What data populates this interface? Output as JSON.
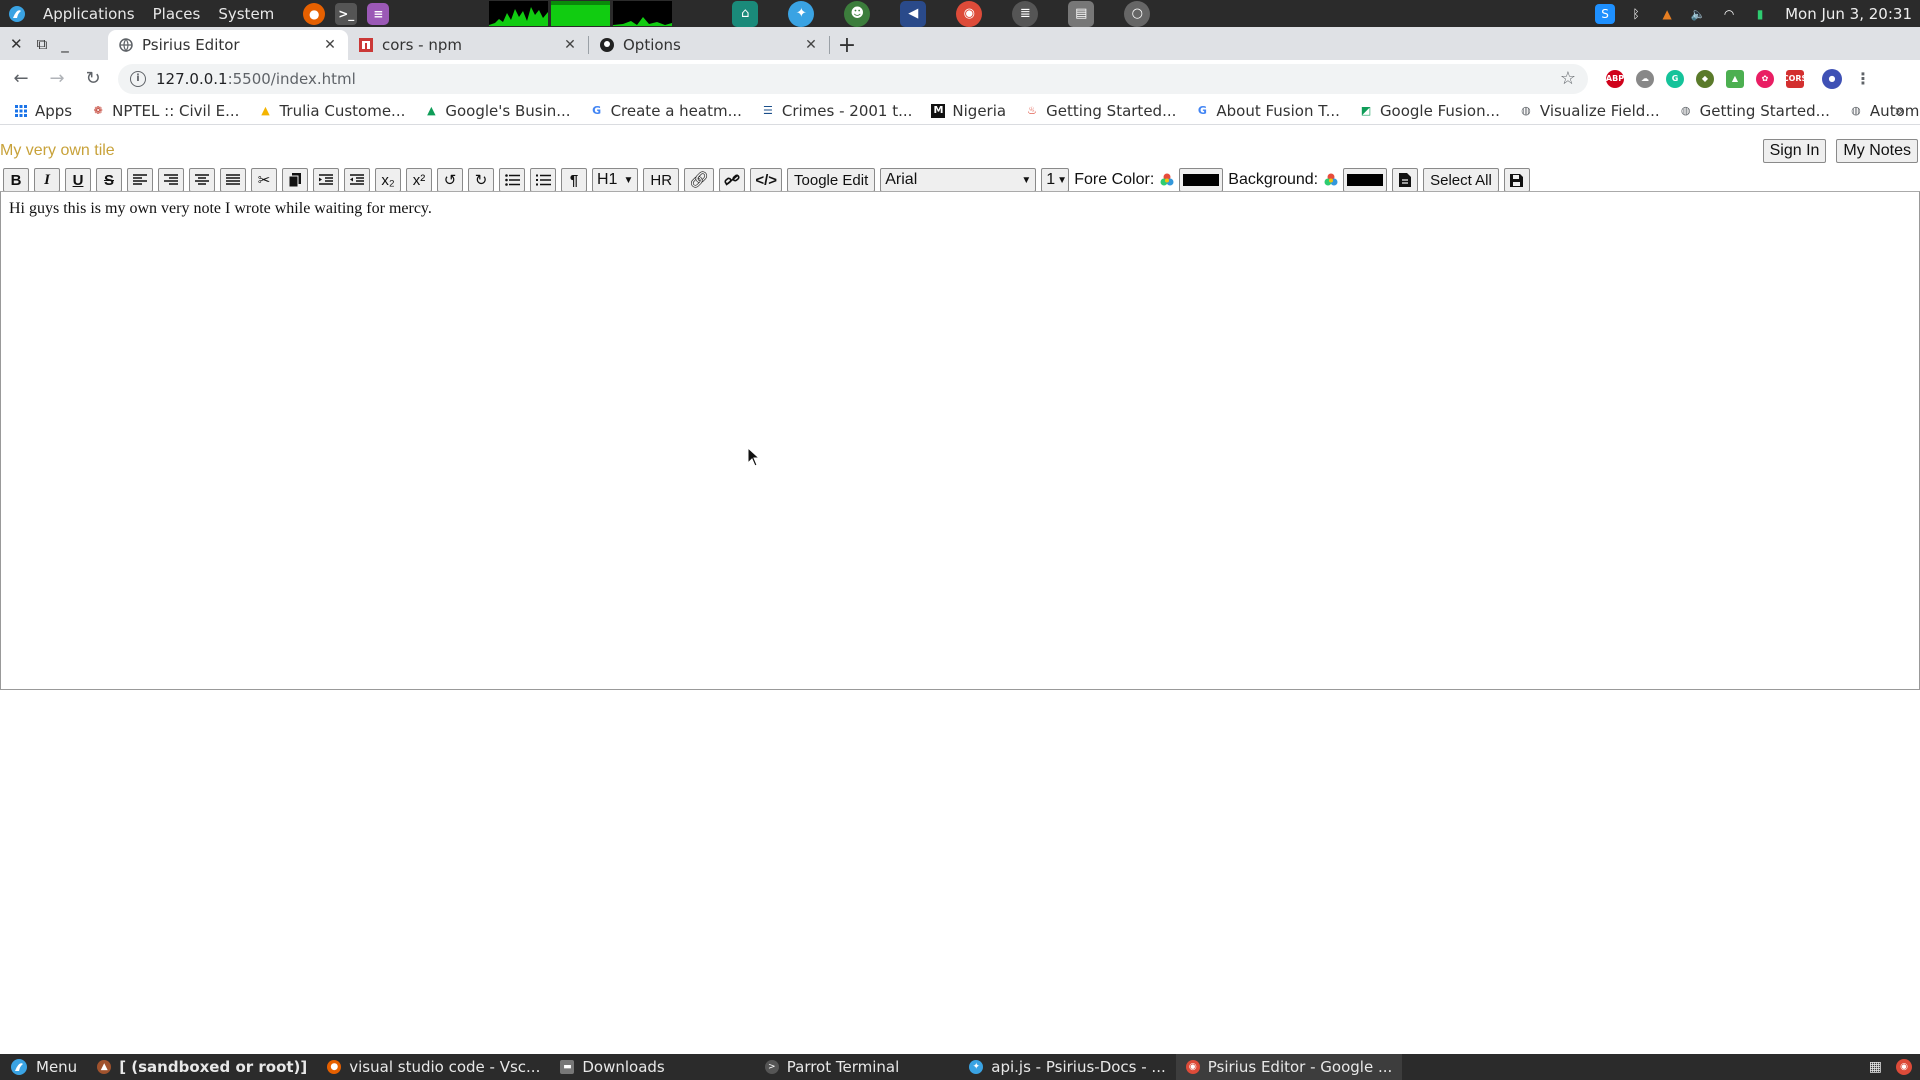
{
  "os_panel": {
    "menus": [
      "Applications",
      "Places",
      "System"
    ],
    "clock": "Mon Jun 3, 20:31"
  },
  "browser": {
    "tabs": [
      {
        "title": "Psirius Editor",
        "active": true
      },
      {
        "title": "cors - npm",
        "active": false
      },
      {
        "title": "Options",
        "active": false
      }
    ],
    "address": {
      "host": "127.0.0.1",
      "path": ":5500/index.html"
    },
    "bookmarks": [
      "Apps",
      "NPTEL :: Civil E...",
      "Trulia Custome...",
      "Google's Busin...",
      "Create a heatm...",
      "Crimes - 2001 t...",
      "Nigeria",
      "Getting Started...",
      "About Fusion T...",
      "Google Fusion...",
      "Visualize Field...",
      "Getting Started...",
      "Automatically s..."
    ],
    "bookmarks_more": "»"
  },
  "page": {
    "note_title": "My very own tile",
    "sign_in": "Sign In",
    "my_notes": "My Notes",
    "toolbar": {
      "bold": "B",
      "italic": "I",
      "underline": "U",
      "strike": "S",
      "subscript": "x₂",
      "superscript": "x²",
      "heading": "H1",
      "hr": "HR",
      "toggle_edit": "Toogle Edit",
      "font": "Arial",
      "size": "1",
      "fore_color_label": "Fore Color:",
      "background_label": "Background:",
      "select_all": "Select All"
    },
    "editor_text": "Hi guys this is my own very note I wrote while waiting for mercy."
  },
  "taskbar": {
    "menu": "Menu",
    "items": [
      "[ (sandboxed or root)]",
      "visual studio code - Vsc...",
      "Downloads",
      "Parrot Terminal",
      "api.js - Psirius-Docs - ...",
      "Psirius Editor - Google ..."
    ]
  },
  "colors": {
    "title_text": "#c8a23a",
    "panel_bg": "#2b2b2b",
    "tab_strip": "#dfe1e5",
    "fore_color": "#000000",
    "background_color": "#000000"
  }
}
